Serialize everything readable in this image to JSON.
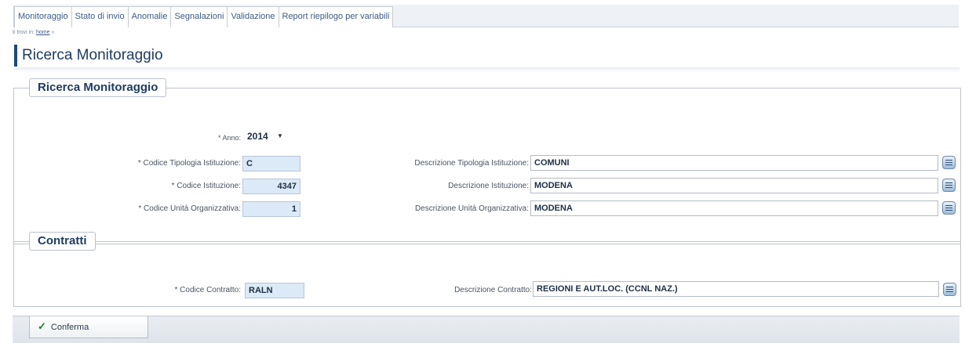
{
  "menu": {
    "tabs": [
      "Monitoraggio",
      "Stato di invio",
      "Anomalie",
      "Segnalazioni",
      "Validazione",
      "Report riepilogo per variabili"
    ]
  },
  "breadcrumb": {
    "prefix": "ti trovi in:",
    "home": "home",
    "sep": "»"
  },
  "page_title": "Ricerca Monitoraggio",
  "ricerca": {
    "legend": "Ricerca Monitoraggio",
    "anno": {
      "label": "* Anno:",
      "value": "2014"
    },
    "codice_tipologia": {
      "label": "* Codice Tipologia Istituzione:",
      "value": "C"
    },
    "codice_istituzione": {
      "label": "* Codice Istituzione:",
      "value": "4347"
    },
    "codice_unita": {
      "label": "* Codice Unità Organizzativa:",
      "value": "1"
    },
    "descr_tipologia": {
      "label": "Descrizione Tipologia Istituzione:",
      "value": "COMUNI"
    },
    "descr_istituzione": {
      "label": "Descrizione Istituzione:",
      "value": "MODENA"
    },
    "descr_unita": {
      "label": "Descrizione Unità Organizzativa:",
      "value": "MODENA"
    }
  },
  "contratti": {
    "legend": "Contratti",
    "codice_contratto": {
      "label": "* Codice Contratto:",
      "value": "RALN"
    },
    "descr_contratto": {
      "label": "Descrizione Contratto:",
      "value": "REGIONI E AUT.LOC. (CCNL NAZ.)"
    }
  },
  "footer": {
    "confirm_label": "Conferma"
  }
}
